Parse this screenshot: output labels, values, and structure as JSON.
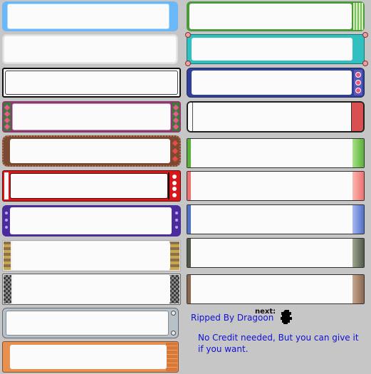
{
  "credit": {
    "ripped_by": "Ripped  By Dragoon",
    "next_label": "next:",
    "note_line1": "No Credit needed, But you can give it",
    "note_line2": "if you want."
  },
  "icons": {
    "next_icon": "pokeball-silhouette-icon"
  },
  "colors": {
    "text": "#1010d8",
    "background": "#c6c6c6",
    "panel_fill": "#fbfbfb"
  }
}
